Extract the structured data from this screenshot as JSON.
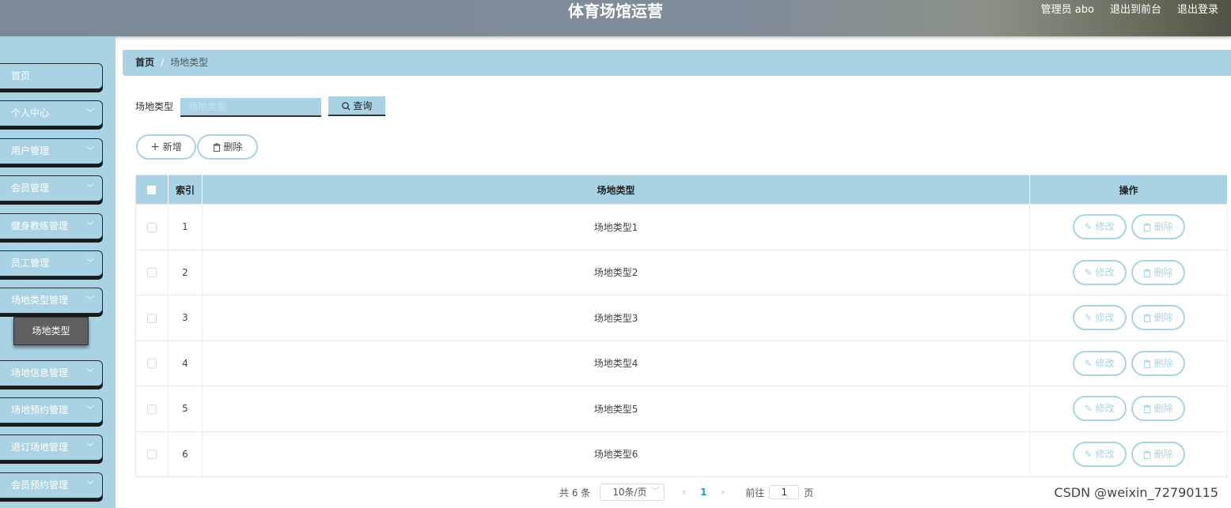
{
  "header": {
    "title": "体育场馆运营",
    "user": "管理员 abo",
    "back_front": "退出到前台",
    "logout": "退出登录"
  },
  "sidebar": {
    "items": [
      {
        "label": "首页",
        "has_arrow": false
      },
      {
        "label": "个人中心",
        "has_arrow": true
      },
      {
        "label": "用户管理",
        "has_arrow": true
      },
      {
        "label": "会员管理",
        "has_arrow": true
      },
      {
        "label": "健身教练管理",
        "has_arrow": true
      },
      {
        "label": "员工管理",
        "has_arrow": true
      },
      {
        "label": "场地类型管理",
        "has_arrow": true
      },
      {
        "label": "场地信息管理",
        "has_arrow": true
      },
      {
        "label": "场地预约管理",
        "has_arrow": true
      },
      {
        "label": "退订场地管理",
        "has_arrow": true
      },
      {
        "label": "会员预约管理",
        "has_arrow": true
      }
    ],
    "active_sub": "场地类型"
  },
  "breadcrumb": {
    "home": "首页",
    "separator": "/",
    "current": "场地类型"
  },
  "search": {
    "label": "场地类型",
    "placeholder": "场地类型",
    "value": "",
    "button": "查询"
  },
  "actions": {
    "add": "新增",
    "delete": "删除"
  },
  "table": {
    "columns": [
      "索引",
      "场地类型",
      "操作"
    ],
    "rows": [
      {
        "index": "1",
        "type": "场地类型1"
      },
      {
        "index": "2",
        "type": "场地类型2"
      },
      {
        "index": "3",
        "type": "场地类型3"
      },
      {
        "index": "4",
        "type": "场地类型4"
      },
      {
        "index": "5",
        "type": "场地类型5"
      },
      {
        "index": "6",
        "type": "场地类型6"
      }
    ],
    "edit_label": "修改",
    "delete_label": "删除"
  },
  "pagination": {
    "total": "共 6 条",
    "page_size": "10条/页",
    "current": "1",
    "goto_label": "前往",
    "goto_value": "1",
    "page_suffix": "页"
  },
  "watermark": "CSDN @weixin_72790115",
  "colors": {
    "accent": "#a9d3e4",
    "submenu_active": "#5f5f5f"
  }
}
